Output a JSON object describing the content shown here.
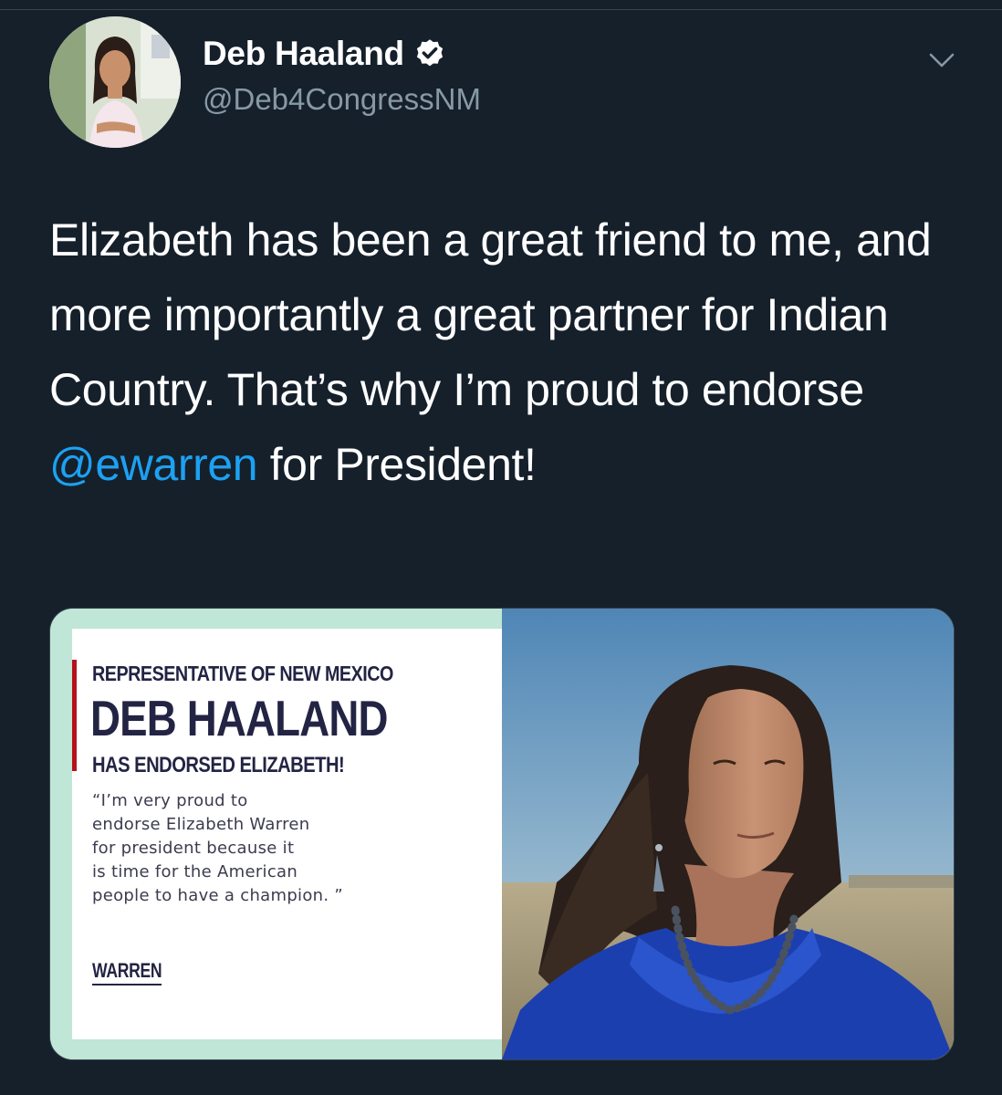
{
  "tweet": {
    "display_name": "Deb Haaland",
    "handle": "@Deb4CongressNM",
    "text_before": "Elizabeth has been a great friend to me, and more importantly a great partner for Indian Country. That’s why I’m proud to endorse ",
    "mention": "@ewarren",
    "text_after": " for President!",
    "icons": {
      "verified": "verified-badge-icon",
      "menu": "chevron-down-icon"
    }
  },
  "media": {
    "kicker": "REPRESENTATIVE OF NEW MEXICO",
    "name": "DEB HAALAND",
    "endorsed": "HAS ENDORSED ELIZABETH!",
    "quote_lines": [
      "“I’m very proud to",
      "endorse Elizabeth Warren",
      "for president because it",
      "is time for the American",
      "people to have a champion. ”"
    ],
    "logo": "WARREN"
  },
  "colors": {
    "background": "#15202b",
    "text": "#ffffff",
    "secondary_text": "#8899a6",
    "link": "#1da1f2",
    "graphic_navy": "#232444",
    "graphic_red": "#b5121b",
    "graphic_mint": "#bfe6d6"
  }
}
